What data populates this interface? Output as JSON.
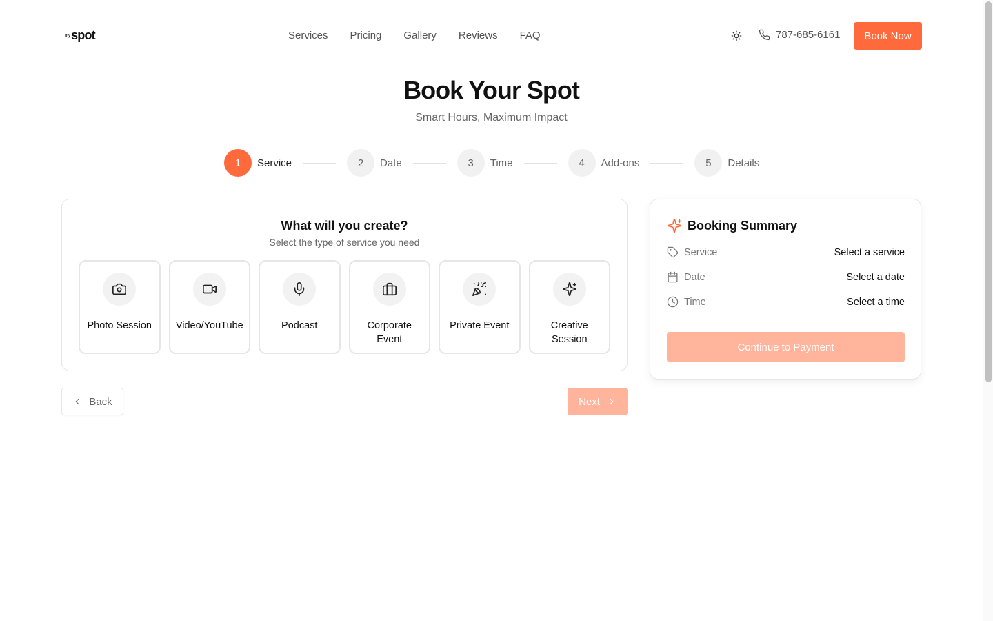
{
  "header": {
    "logo_small": "my",
    "logo_main": "spot",
    "nav": [
      "Services",
      "Pricing",
      "Gallery",
      "Reviews",
      "FAQ"
    ],
    "phone": "787-685-6161",
    "book_label": "Book Now"
  },
  "hero": {
    "title": "Book Your Spot",
    "subtitle": "Smart Hours, Maximum Impact"
  },
  "stepper": {
    "current": 1,
    "steps": [
      {
        "number": "1",
        "label": "Service"
      },
      {
        "number": "2",
        "label": "Date"
      },
      {
        "number": "3",
        "label": "Time"
      },
      {
        "number": "4",
        "label": "Add-ons"
      },
      {
        "number": "5",
        "label": "Details"
      }
    ]
  },
  "service_card": {
    "title": "What will you create?",
    "subtitle": "Select the type of service you need",
    "options": [
      {
        "label": "Photo Session",
        "icon": "camera-icon"
      },
      {
        "label": "Video/YouTube",
        "icon": "video-icon"
      },
      {
        "label": "Podcast",
        "icon": "microphone-icon"
      },
      {
        "label": "Corporate Event",
        "icon": "briefcase-icon"
      },
      {
        "label": "Private Event",
        "icon": "party-popper-icon"
      },
      {
        "label": "Creative Session",
        "icon": "sparkles-icon"
      }
    ]
  },
  "nav_buttons": {
    "back": "Back",
    "next": "Next"
  },
  "summary": {
    "title": "Booking Summary",
    "rows": [
      {
        "label": "Service",
        "value": "Select a service",
        "icon": "tag-icon"
      },
      {
        "label": "Date",
        "value": "Select a date",
        "icon": "calendar-icon"
      },
      {
        "label": "Time",
        "value": "Select a time",
        "icon": "clock-icon"
      }
    ],
    "pay_label": "Continue to Payment"
  },
  "colors": {
    "accent": "#ff6a3d",
    "accent_disabled": "#ffb49b"
  }
}
